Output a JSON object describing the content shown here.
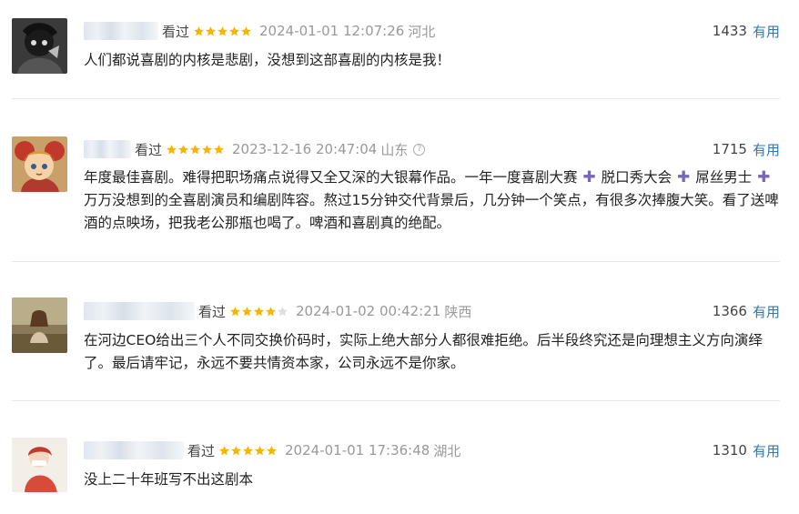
{
  "reviews": [
    {
      "watched_label": "看过",
      "rating": 5,
      "time": "2024-01-01 12:07:26",
      "location": "河北",
      "votes": "1433",
      "useful_label": "有用",
      "content": "人们都说喜剧的内核是悲剧，没想到这部喜剧的内核是我！"
    },
    {
      "watched_label": "看过",
      "rating": 5,
      "time": "2023-12-16 20:47:04",
      "location": "山东",
      "votes": "1715",
      "useful_label": "有用",
      "content_parts": [
        "年度最佳喜剧。难得把职场痛点说得又全又深的大银幕作品。一年一度喜剧大赛",
        "脱口秀大会",
        "屌丝男士",
        "万万没想到的全喜剧演员和编剧阵容。熬过15分钟交代背景后，几分钟一个笑点，有很多次捧腹大笑。看了送啤酒的点映场，把我老公那瓶也喝了。啤酒和喜剧真的绝配。"
      ]
    },
    {
      "watched_label": "看过",
      "rating": 4,
      "time": "2024-01-02 00:42:21",
      "location": "陕西",
      "votes": "1366",
      "useful_label": "有用",
      "content": "在河边CEO给出三个人不同交换价码时，实际上绝大部分人都很难拒绝。后半段终究还是向理想主义方向演绎了。最后请牢记，永远不要共情资本家，公司永远不是你家。"
    },
    {
      "watched_label": "看过",
      "rating": 5,
      "time": "2024-01-01 17:36:48",
      "location": "湖北",
      "votes": "1310",
      "useful_label": "有用",
      "content": "没上二十年班写不出这剧本"
    }
  ],
  "colors": {
    "star": "#f7b500",
    "star_empty": "#dddddd",
    "useful_link": "#3377aa",
    "plus_icon": "#7767b5"
  }
}
